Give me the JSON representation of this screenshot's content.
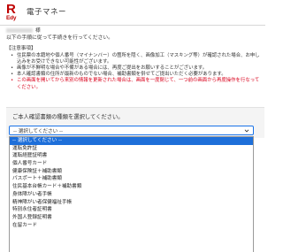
{
  "header": {
    "logo_r": "R",
    "logo_edy": "Edy",
    "title": "電子マネー"
  },
  "greeting": {
    "suffix": "様",
    "lead": "以下の手順に従って手続きを行ってください。"
  },
  "notes": {
    "heading": "【注意事項】",
    "items": [
      {
        "text": "住民票の本籍地や個人番号（マイナンバー）の箇所を隠く、画像加工（マスキング等）が確認された場合、お申し込みをお受けできない可能性がございます。",
        "emphasis": false
      },
      {
        "text": "画像が不鮮明な場合や不備がある場合には、再度ご提出をお願いすることがございます。",
        "emphasis": false
      },
      {
        "text": "本人確認書類の住所が最新のものでない場合、補助書類を併せてご提出いただく必要があります。",
        "emphasis": false
      },
      {
        "text": "この画面を開いてから来別の情報を更新された場合は、画面を一度閉じて、一つ前の画面から再度操作を行なってください。",
        "emphasis": true
      }
    ]
  },
  "document_select": {
    "question": "ご本人確認書類の種類を選択してください。",
    "current_value": "-- 選択してください --",
    "options": [
      "-- 選択してください --",
      "運転免許証",
      "運転経歴証明書",
      "個人番号カード",
      "健康保険証＋補助書類",
      "パスポート＋補助書類",
      "住民基本台帳カード＋補助書類",
      "身体障がい者手帳",
      "精神障がい者保健福祉手帳",
      "特別永住者証明書",
      "外国人登録証明書",
      "在留カード"
    ],
    "highlighted_index": 0
  },
  "colors": {
    "brand": "#bf0000",
    "warning_text": "#d9001b",
    "focus_border": "#1a73e8",
    "option_highlight": "#1e6fd9",
    "panel_bg": "#f4f4f4"
  },
  "icons": {
    "select_toggle": "chevron-down-icon"
  }
}
